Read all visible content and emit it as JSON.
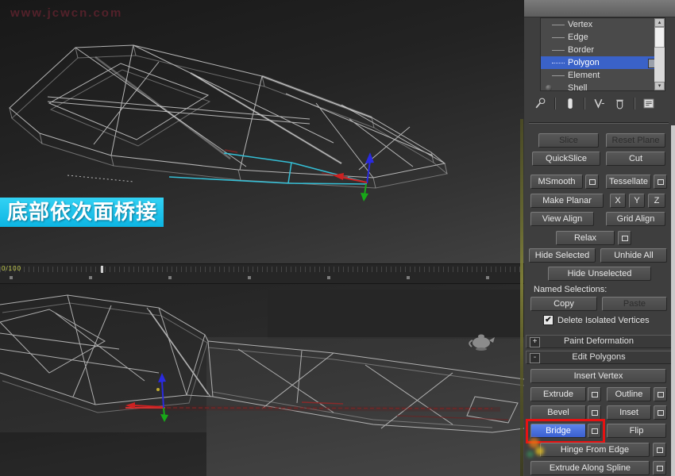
{
  "watermark": {
    "text": "www.jcwcn.com"
  },
  "caption": {
    "text": "底部依次面桥接"
  },
  "timeline": {
    "frame_label": "0/100"
  },
  "viewport": {
    "wire_color": "#cfcfcf",
    "bridge_edge_color": "#35c6de",
    "selected_edge_color": "#c23030",
    "axis_colors": {
      "x": "#cc2222",
      "y": "#18a818",
      "z": "#2a2ae0"
    }
  },
  "modifier_stack": {
    "items": [
      "Vertex",
      "Edge",
      "Border",
      "Polygon",
      "Element",
      "Shell"
    ],
    "selected": "Polygon",
    "selected_color": "#3a62c8"
  },
  "stack_toolbar": {
    "icons": [
      "pin-stack",
      "show-end-result",
      "make-unique",
      "remove-modifier",
      "configure-modifier-sets"
    ]
  },
  "edit_geometry": {
    "slice": "Slice",
    "reset_plane": "Reset Plane",
    "quickslice": "QuickSlice",
    "cut": "Cut",
    "msmooth": "MSmooth",
    "tessellate": "Tessellate",
    "make_planar": "Make Planar",
    "axis_x": "X",
    "axis_y": "Y",
    "axis_z": "Z",
    "view_align": "View Align",
    "grid_align": "Grid Align",
    "relax": "Relax",
    "hide_selected": "Hide Selected",
    "unhide_all": "Unhide All",
    "hide_unselected": "Hide Unselected",
    "named_selections": "Named Selections:",
    "copy": "Copy",
    "paste": "Paste",
    "delete_isolated_vertices": "Delete Isolated Vertices",
    "delete_isolated_checked": true,
    "check_glyph": "✔"
  },
  "rollouts": {
    "collapsed_glyph": "+",
    "expanded_glyph": "-",
    "paint_deformation": "Paint Deformation",
    "edit_polygons": "Edit Polygons"
  },
  "edit_polygons": {
    "insert_vertex": "Insert Vertex",
    "extrude": "Extrude",
    "outline": "Outline",
    "bevel": "Bevel",
    "inset": "Inset",
    "bridge": "Bridge",
    "flip": "Flip",
    "hinge_from_edge": "Hinge From Edge",
    "extrude_along_spline": "Extrude Along Spline"
  },
  "annotation": {
    "highlight_color": "#e61212",
    "highlighted_button": "Bridge"
  }
}
